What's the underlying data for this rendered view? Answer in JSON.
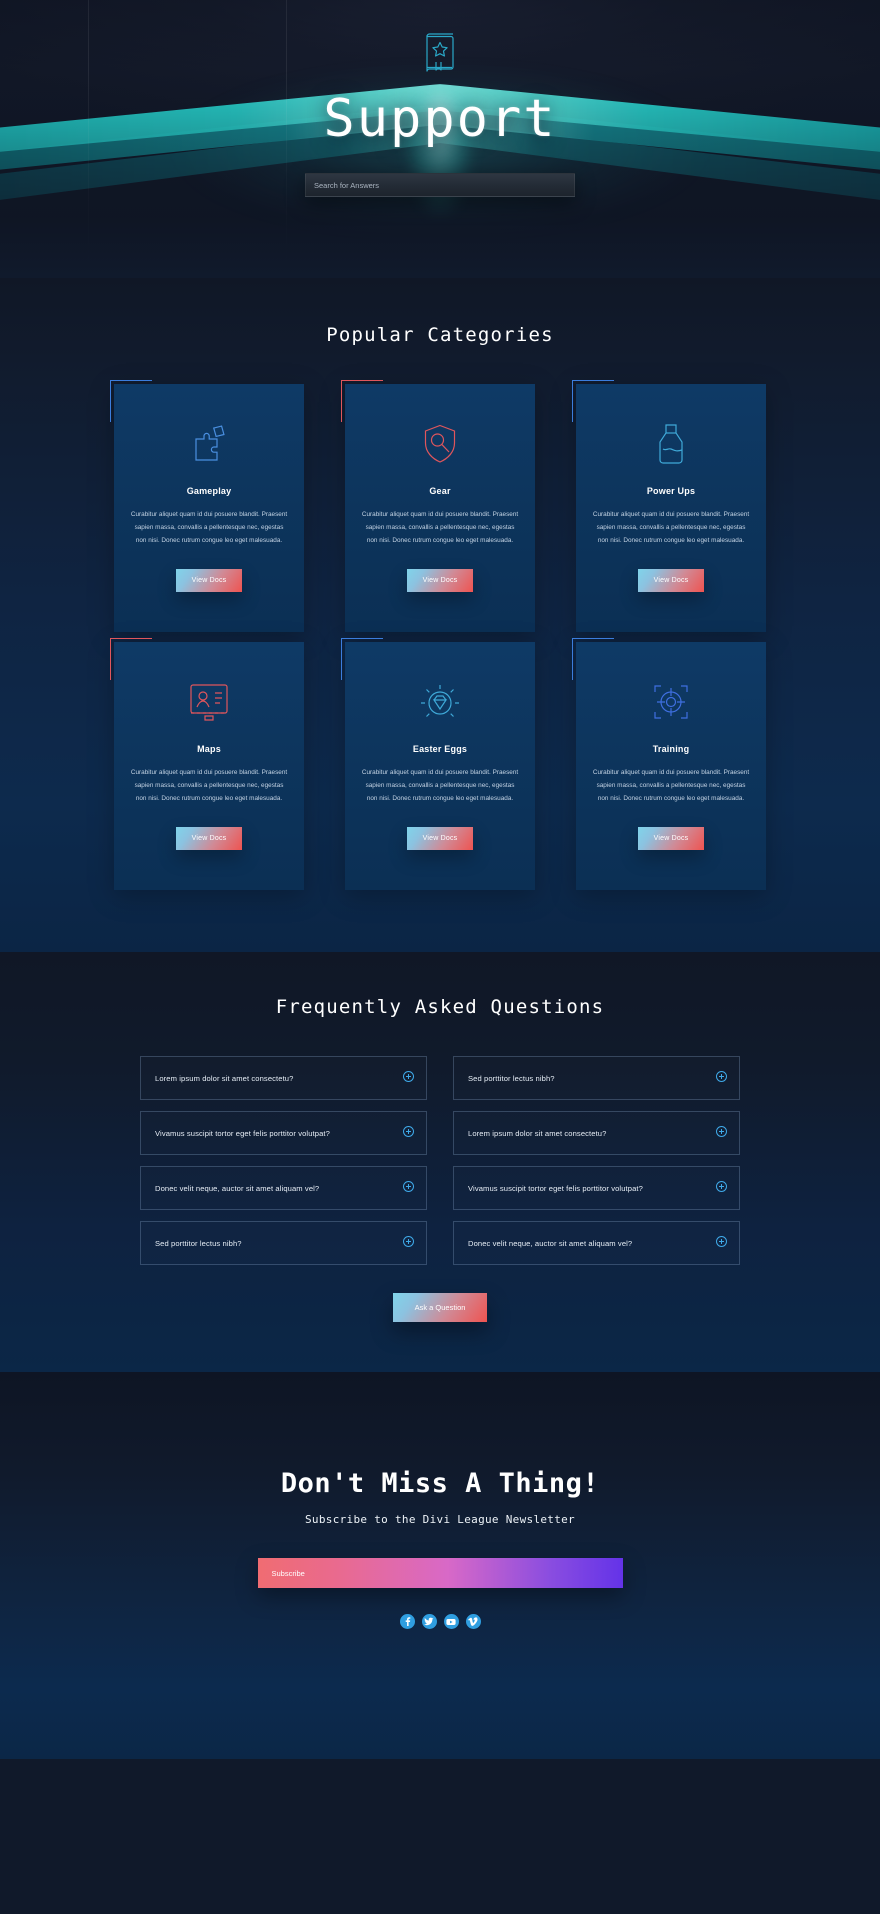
{
  "hero": {
    "icon": "book-star-icon",
    "title": "Support",
    "search_placeholder": "Search for Answers",
    "search_value": ""
  },
  "categories": {
    "title": "Popular Categories",
    "body_text": "Curabitur aliquet quam id dui posuere blandit. Praesent sapien massa, convallis a pellentesque nec, egestas non nisi. Donec rutrum congue leo eget malesuada.",
    "button_label": "View Docs",
    "items": [
      {
        "title": "Gameplay",
        "icon": "puzzle-icon",
        "corner": "blue"
      },
      {
        "title": "Gear",
        "icon": "shield-gear-icon",
        "corner": "red"
      },
      {
        "title": "Power Ups",
        "icon": "potion-icon",
        "corner": "blue"
      },
      {
        "title": "Maps",
        "icon": "map-screen-icon",
        "corner": "red"
      },
      {
        "title": "Easter Eggs",
        "icon": "diamond-icon",
        "corner": "blue"
      },
      {
        "title": "Training",
        "icon": "target-icon",
        "corner": "blue"
      }
    ]
  },
  "faq": {
    "title": "Frequently Asked Questions",
    "toggle_icon": "plus-circle-icon",
    "items": [
      "Lorem ipsum dolor sit amet consectetu?",
      "Sed porttitor lectus nibh?",
      "Vivamus suscipit tortor eget felis porttitor volutpat?",
      "Lorem ipsum dolor sit amet consectetu?",
      "Donec velit neque, auctor sit amet aliquam vel?",
      "Vivamus suscipit tortor eget felis porttitor volutpat?",
      "Sed porttitor lectus nibh?",
      "Donec velit neque, auctor sit amet aliquam vel?"
    ],
    "ask_button_label": "Ask a Question"
  },
  "newsletter": {
    "title": "Don't Miss A Thing!",
    "subtitle": "Subscribe to the Divi League Newsletter",
    "subscribe_label": "Subscribe",
    "socials": [
      {
        "name": "facebook-icon",
        "color": "#2f9ee0",
        "glyph": "f"
      },
      {
        "name": "twitter-icon",
        "color": "#2f9ee0",
        "glyph": "t"
      },
      {
        "name": "youtube-icon",
        "color": "#2f9ee0",
        "glyph": "y"
      },
      {
        "name": "vimeo-icon",
        "color": "#2f9ee0",
        "glyph": "v"
      }
    ]
  },
  "colors": {
    "neon": "#2ad8d2",
    "card_bg": "#0d355d",
    "corner_blue": "#3b7ddd",
    "corner_red": "#e0565c",
    "btn_gradient_from": "#7fd4ea",
    "btn_gradient_to": "#ef5350",
    "subscribe_from": "#f06c72",
    "subscribe_to": "#6433e8"
  }
}
